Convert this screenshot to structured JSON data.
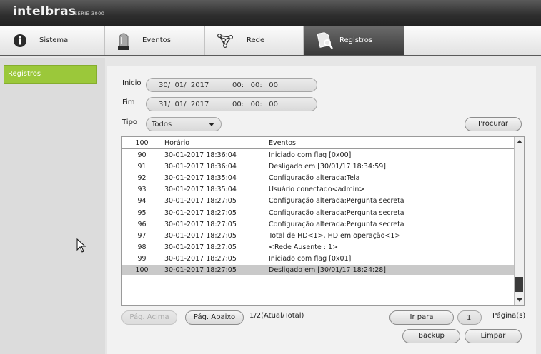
{
  "header": {
    "brand": "intelbras",
    "series": "SÉRIE 3000"
  },
  "tabs": [
    {
      "label": "Sistema",
      "icon": "info-icon",
      "active": false
    },
    {
      "label": "Eventos",
      "icon": "alarm-light-icon",
      "active": false
    },
    {
      "label": "Rede",
      "icon": "network-icon",
      "active": false
    },
    {
      "label": "Registros",
      "icon": "search-document-icon",
      "active": true
    }
  ],
  "sidebar": {
    "items": [
      {
        "label": "Registros",
        "active": true
      }
    ]
  },
  "filters": {
    "start_label": "Inicio",
    "start_date": "30/  01/  2017",
    "start_time": "00:   00:   00",
    "end_label": "Fim",
    "end_date": "31/  01/  2017",
    "end_time": "00:   00:   00",
    "type_label": "Tipo",
    "type_value": "Todos",
    "search_label": "Procurar"
  },
  "table": {
    "headers": [
      "100",
      "Horário",
      "Eventos"
    ],
    "rows": [
      {
        "no": "90",
        "time": "30-01-2017 18:36:04",
        "event": "Iniciado com flag [0x00]"
      },
      {
        "no": "91",
        "time": "30-01-2017 18:36:04",
        "event": "Desligado em [30/01/17 18:34:59]"
      },
      {
        "no": "92",
        "time": "30-01-2017 18:35:04",
        "event": "Configuração alterada:Tela"
      },
      {
        "no": "93",
        "time": "30-01-2017 18:35:04",
        "event": "Usuário conectado<admin>"
      },
      {
        "no": "94",
        "time": "30-01-2017 18:27:05",
        "event": "Configuração alterada:Pergunta secreta"
      },
      {
        "no": "95",
        "time": "30-01-2017 18:27:05",
        "event": "Configuração alterada:Pergunta secreta"
      },
      {
        "no": "96",
        "time": "30-01-2017 18:27:05",
        "event": "Configuração alterada:Pergunta secreta"
      },
      {
        "no": "97",
        "time": "30-01-2017 18:27:05",
        "event": "Total de HD<1>, HD em operação<1>"
      },
      {
        "no": "98",
        "time": "30-01-2017 18:27:05",
        "event": "<Rede Ausente : 1>"
      },
      {
        "no": "99",
        "time": "30-01-2017 18:27:05",
        "event": "Iniciado com flag [0x01]"
      },
      {
        "no": "100",
        "time": "30-01-2017 18:27:05",
        "event": "Desligado em [30/01/17 18:24:28]"
      }
    ],
    "selected_index": 10
  },
  "pager": {
    "prev_label": "Pág. Acima",
    "next_label": "Pág. Abaixo",
    "status": "1/2(Atual/Total)",
    "goto_label": "Ir para",
    "page_value": "1",
    "page_suffix": "Página(s)"
  },
  "actions": {
    "backup_label": "Backup",
    "clear_label": "Limpar"
  }
}
